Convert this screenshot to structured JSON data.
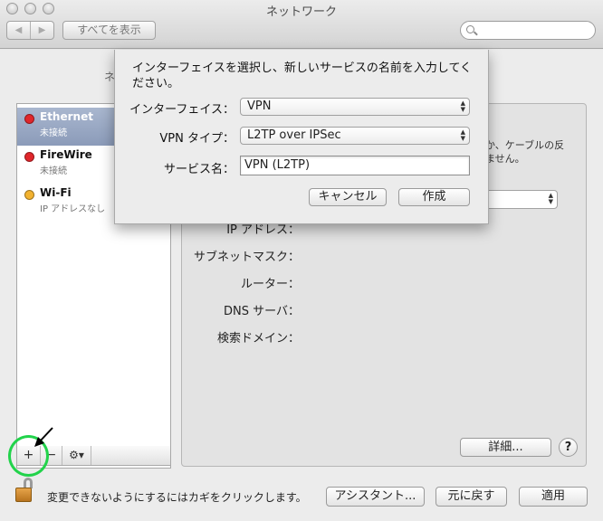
{
  "window": {
    "title": "ネットワーク"
  },
  "toolbar": {
    "back": "◀",
    "forward": "▶",
    "show_all": "すべてを表示",
    "search_placeholder": ""
  },
  "background": {
    "location_label_partial": "ネ",
    "services": [
      {
        "name": "Ethernet",
        "status": "未接続",
        "dot_color": "#e0262b",
        "selected": true
      },
      {
        "name": "FireWire",
        "status": "未接続",
        "dot_color": "#e0262b",
        "selected": false
      },
      {
        "name": "Wi-Fi",
        "status": "IP アドレスなし",
        "dot_color": "#f2b230",
        "selected": false
      }
    ],
    "sidebar_toolbar": {
      "add": "+",
      "remove": "−",
      "gear": "⚙▾"
    },
    "detail_text": "か、ケーブルの反\nません。",
    "fields": [
      {
        "label": "IP アドレス："
      },
      {
        "label": "サブネットマスク："
      },
      {
        "label": "ルーター："
      },
      {
        "label": "DNS サーバ："
      },
      {
        "label": "検索ドメイン："
      }
    ],
    "details_button": "詳細...",
    "help_button": "?"
  },
  "footer": {
    "lock_text": "変更できないようにするにはカギをクリックします。",
    "assistant_button": "アシスタント...",
    "revert_button": "元に戻す",
    "apply_button": "適用"
  },
  "sheet": {
    "message": "インターフェイスを選択し、新しいサービスの名前を入力してください。",
    "interface_label": "インターフェイス：",
    "interface_value": "VPN",
    "vpn_type_label": "VPN タイプ：",
    "vpn_type_value": "L2TP over IPSec",
    "service_name_label": "サービス名：",
    "service_name_value": "VPN (L2TP)",
    "cancel_button": "キャンセル",
    "create_button": "作成"
  },
  "colors": {
    "annotation_ring": "#22d34b",
    "selection": "#8b9bb9"
  }
}
